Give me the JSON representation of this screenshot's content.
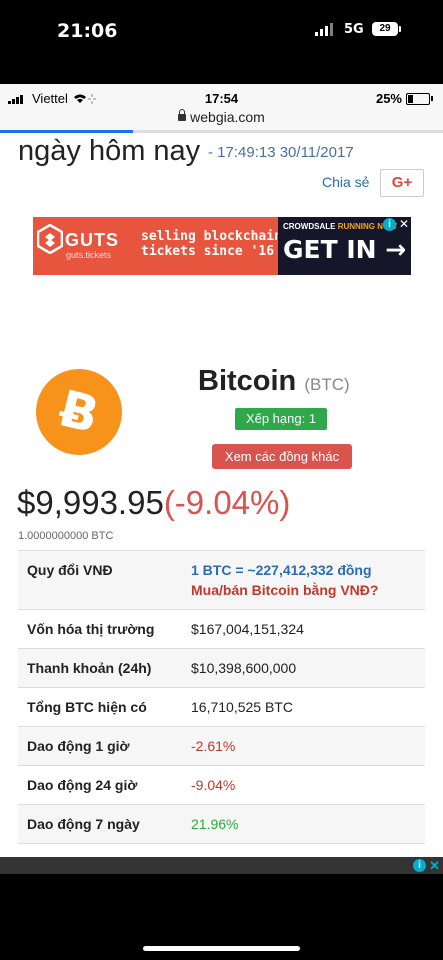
{
  "outer_status": {
    "time": "21:06",
    "network": "5G",
    "battery": "29"
  },
  "ios_status": {
    "carrier": "Viettel",
    "time": "17:54",
    "battery": "25%",
    "battery_level": 0.25
  },
  "browser": {
    "url": "webgia.com",
    "load_progress": 0.3
  },
  "page": {
    "heading": "ngày hôm nay",
    "timestamp": "- 17:49:13 30/11/2017",
    "share_label": "Chia sẻ",
    "gplus_label": "G+"
  },
  "ad": {
    "brand": "GUTS",
    "brand_sub": "guts.tickets",
    "line1": "selling blockchain",
    "line2": "tickets since '16",
    "crowdsale": "CROWDSALE",
    "running": "RUNNING NOW",
    "cta": "GET IN →",
    "close": "✕",
    "info": "i"
  },
  "coin": {
    "name": "Bitcoin",
    "symbol": "(BTC)",
    "rank": "Xếp hạng: 1",
    "other_button": "Xem các đồng khác",
    "price": "$9,993.95",
    "change": "(-9.04%)",
    "amount": "1.0000000000 BTC",
    "color": "#f7931a"
  },
  "stats": {
    "convert_label": "Quy đổi VNĐ",
    "convert_value": "1 BTC = ~227,412,332 đồng",
    "convert_link": "Mua/bán Bitcoin bằng VNĐ?",
    "rows": [
      {
        "label": "Vốn hóa thị trường",
        "value": "$167,004,151,324"
      },
      {
        "label": "Thanh khoản (24h)",
        "value": "$10,398,600,000"
      },
      {
        "label": "Tổng BTC hiện có",
        "value": "16,710,525 BTC"
      },
      {
        "label": "Dao động 1 giờ",
        "value": "-2.61%"
      },
      {
        "label": "Dao động 24 giờ",
        "value": "-9.04%"
      },
      {
        "label": "Dao động 7 ngày",
        "value": "21.96%"
      }
    ]
  },
  "bottom_ad": {
    "info": "i",
    "close": "✕"
  }
}
